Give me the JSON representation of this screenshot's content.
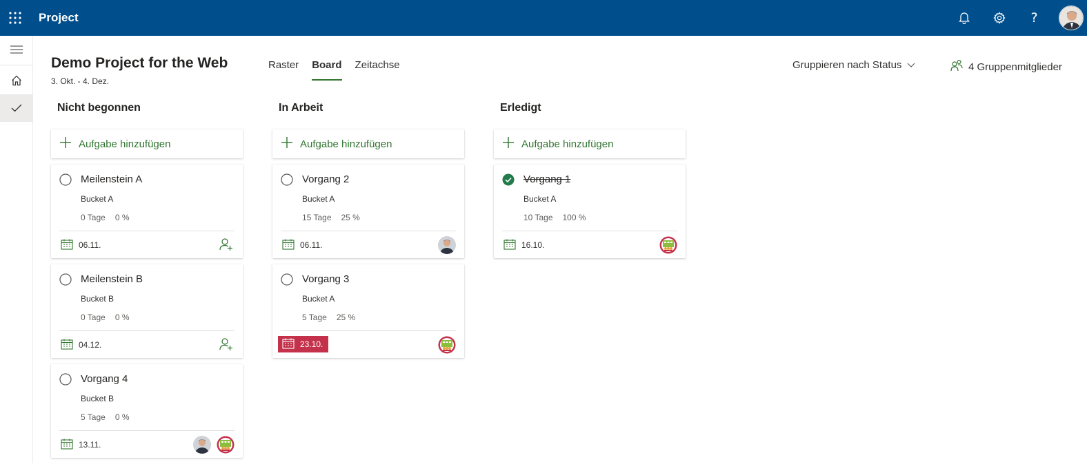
{
  "app": {
    "title": "Project"
  },
  "project": {
    "title": "Demo Project for the Web",
    "dates": "3. Okt. - 4. Dez."
  },
  "tabs": [
    {
      "label": "Raster",
      "active": false
    },
    {
      "label": "Board",
      "active": true
    },
    {
      "label": "Zeitachse",
      "active": false
    }
  ],
  "group_by": {
    "label": "Gruppieren nach Status"
  },
  "members": {
    "label": "4 Gruppenmitglieder"
  },
  "add_task_label": "Aufgabe hinzufügen",
  "colors": {
    "topbar": "#004e8c",
    "accent_green": "#31752f",
    "overdue_red": "#c4314b"
  },
  "columns": [
    {
      "title": "Nicht begonnen",
      "tasks": [
        {
          "name": "Meilenstein A",
          "bucket": "Bucket A",
          "duration": "0 Tage",
          "progress": "0 %",
          "date": "06.11.",
          "overdue": false,
          "done": false,
          "assignees": []
        },
        {
          "name": "Meilenstein B",
          "bucket": "Bucket B",
          "duration": "0 Tage",
          "progress": "0 %",
          "date": "04.12.",
          "overdue": false,
          "done": false,
          "assignees": []
        },
        {
          "name": "Vorgang 4",
          "bucket": "Bucket B",
          "duration": "5 Tage",
          "progress": "0 %",
          "date": "13.11.",
          "overdue": false,
          "done": false,
          "assignees": [
            "person-avatar",
            "group-avatar"
          ]
        }
      ]
    },
    {
      "title": "In Arbeit",
      "tasks": [
        {
          "name": "Vorgang 2",
          "bucket": "Bucket A",
          "duration": "15 Tage",
          "progress": "25 %",
          "date": "06.11.",
          "overdue": false,
          "done": false,
          "assignees": [
            "person-avatar"
          ]
        },
        {
          "name": "Vorgang 3",
          "bucket": "Bucket A",
          "duration": "5 Tage",
          "progress": "25 %",
          "date": "23.10.",
          "overdue": true,
          "done": false,
          "assignees": [
            "group-avatar"
          ]
        }
      ]
    },
    {
      "title": "Erledigt",
      "tasks": [
        {
          "name": "Vorgang 1",
          "bucket": "Bucket A",
          "duration": "10 Tage",
          "progress": "100 %",
          "date": "16.10.",
          "overdue": false,
          "done": true,
          "assignees": [
            "group-avatar"
          ]
        }
      ]
    }
  ]
}
